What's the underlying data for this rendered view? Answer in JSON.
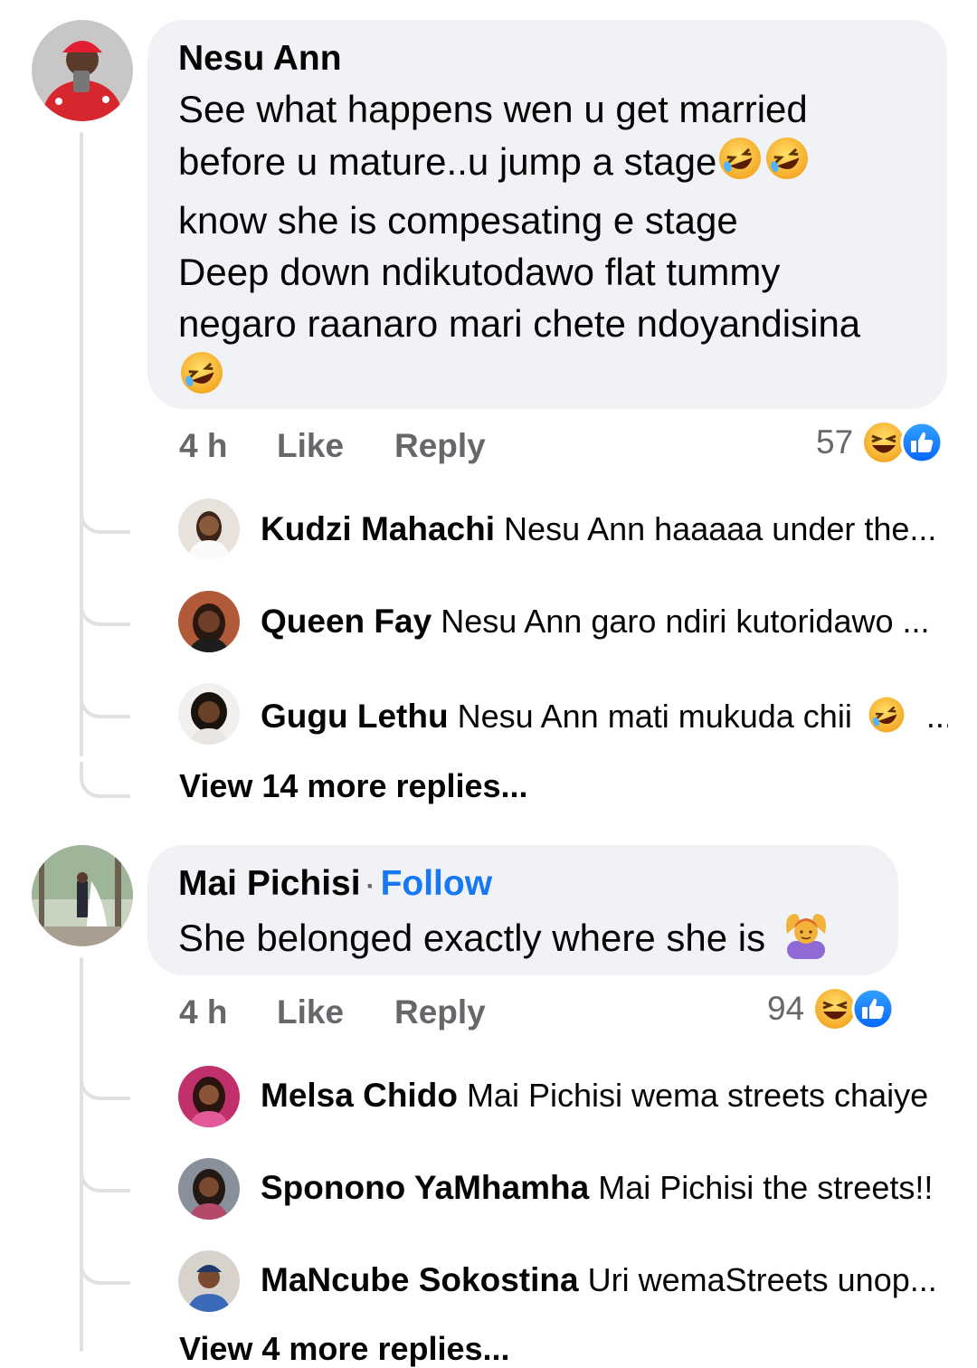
{
  "comments": [
    {
      "author": "Nesu Ann",
      "text_lines": [
        "See what happens wen u get married",
        "before u mature..u jump a stage",
        "know she is compesating e stage",
        "Deep down ndikutodawo flat tummy",
        "negaro raanaro mari chete ndoyandisina"
      ],
      "time": "4 h",
      "like_label": "Like",
      "reply_label": "Reply",
      "reaction_count": "57",
      "reactions": [
        "haha-icon",
        "like-icon"
      ],
      "replies": [
        {
          "author": "Kudzi Mahachi",
          "text": "Nesu Ann haaaaa under the..."
        },
        {
          "author": "Queen Fay",
          "text": "Nesu Ann garo ndiri kutoridawo ..."
        },
        {
          "author": "Gugu Lethu",
          "text": "Nesu Ann mati mukuda chii",
          "trail": "..."
        }
      ],
      "view_more": "View 14 more replies..."
    },
    {
      "author": "Mai Pichisi",
      "follow_label": "Follow",
      "text": "She belonged exactly where she is",
      "time": "4 h",
      "like_label": "Like",
      "reply_label": "Reply",
      "reaction_count": "94",
      "reactions": [
        "haha-icon",
        "like-icon"
      ],
      "replies": [
        {
          "author": "Melsa Chido",
          "text": "Mai Pichisi wema streets chaiye"
        },
        {
          "author": "Sponono YaMhamha",
          "text": "Mai Pichisi the streets!!"
        },
        {
          "author": "MaNcube Sokostina",
          "text": "Uri wemaStreets unop..."
        }
      ],
      "view_more": "View 4 more replies..."
    }
  ],
  "colors": {
    "bubble": "#f0f2f5",
    "meta_text": "#65676b",
    "follow": "#1877f2",
    "thread_line": "#dfe1e5"
  }
}
